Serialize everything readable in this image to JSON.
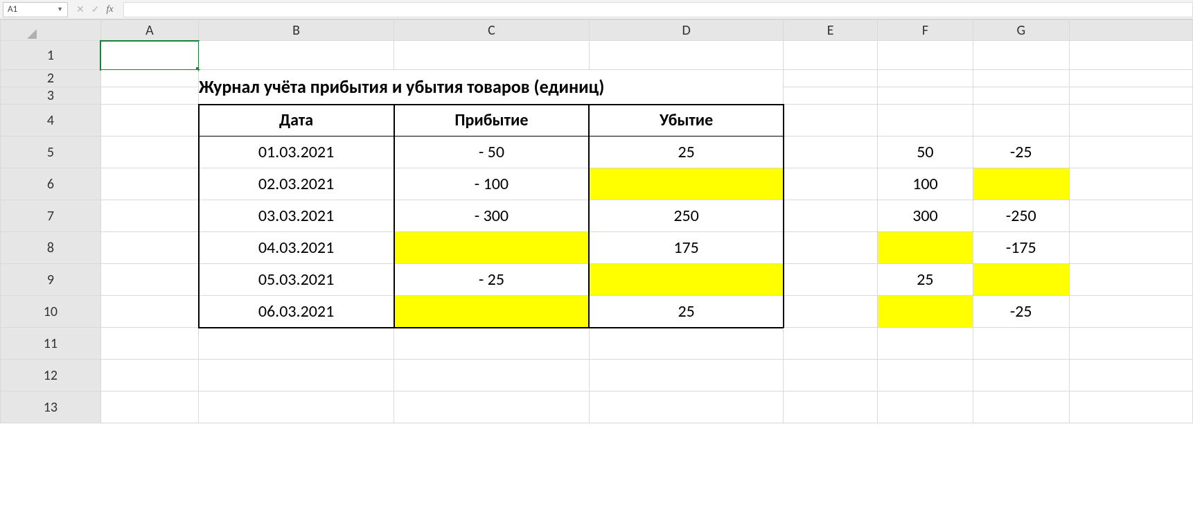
{
  "formula_bar": {
    "namebox": "A1",
    "fx": "fx"
  },
  "columns": [
    "A",
    "B",
    "C",
    "D",
    "E",
    "F",
    "G"
  ],
  "rows": [
    "1",
    "2",
    "3",
    "4",
    "5",
    "6",
    "7",
    "8",
    "9",
    "10",
    "11",
    "12",
    "13"
  ],
  "title": "Журнал учёта прибытия и убытия товаров (единиц)",
  "headers": {
    "date": "Дата",
    "arrival": "Прибытие",
    "departure": "Убытие"
  },
  "data": [
    {
      "date": "01.03.2021",
      "arrival": "- 50",
      "departure": "25",
      "f": "50",
      "g": "-25"
    },
    {
      "date": "02.03.2021",
      "arrival": "- 100",
      "departure": "",
      "f": "100",
      "g": ""
    },
    {
      "date": "03.03.2021",
      "arrival": "- 300",
      "departure": "250",
      "f": "300",
      "g": "-250"
    },
    {
      "date": "04.03.2021",
      "arrival": "",
      "departure": "175",
      "f": "",
      "g": "-175"
    },
    {
      "date": "05.03.2021",
      "arrival": "- 25",
      "departure": "",
      "f": "25",
      "g": ""
    },
    {
      "date": "06.03.2021",
      "arrival": "",
      "departure": "25",
      "f": "",
      "g": "-25"
    }
  ],
  "highlights": {
    "main": {
      "C": [
        8,
        10
      ],
      "D": [
        6,
        9
      ]
    },
    "side": {
      "F": [
        8,
        10
      ],
      "G": [
        6,
        9
      ]
    }
  }
}
